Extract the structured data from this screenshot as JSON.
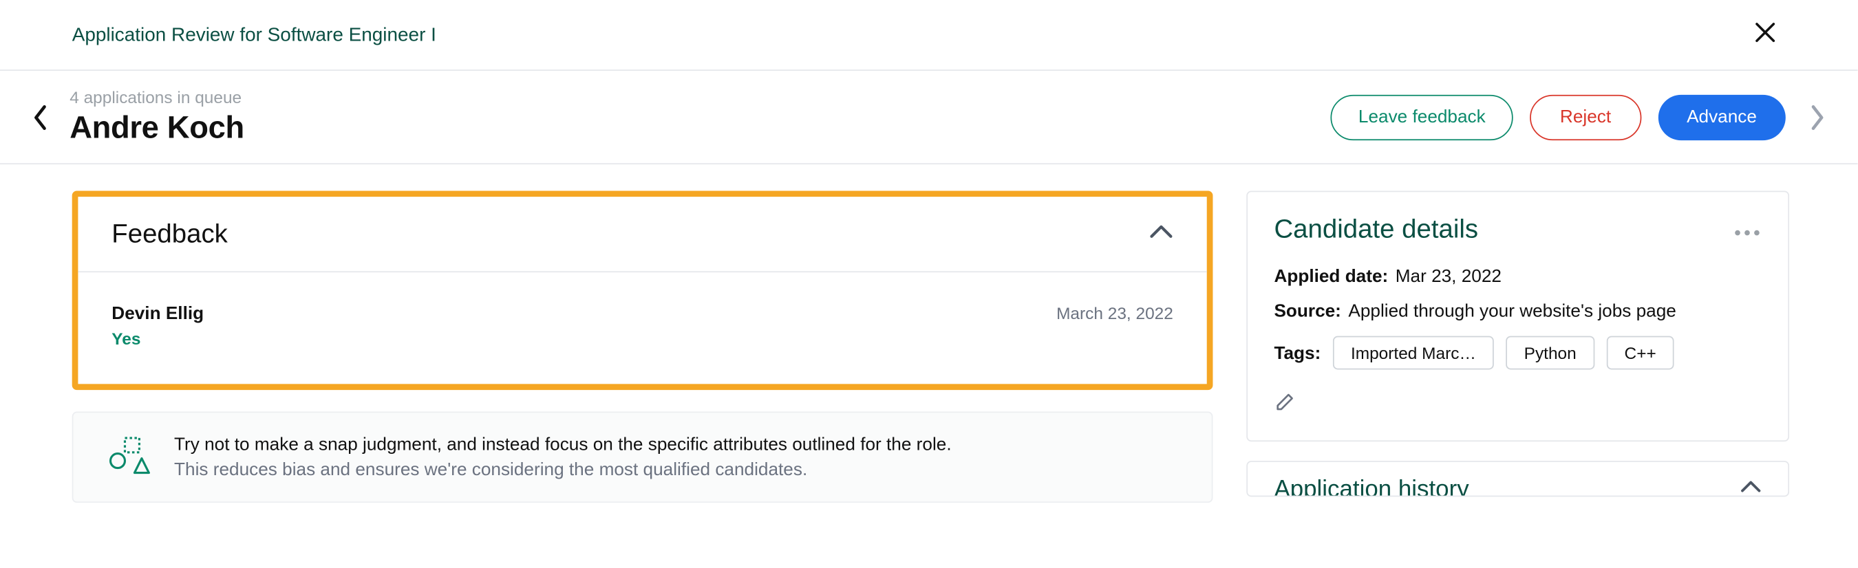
{
  "page": {
    "title": "Application Review for Software Engineer I"
  },
  "header": {
    "queue_text": "4 applications in queue",
    "candidate_name": "Andre Koch",
    "actions": {
      "leave_feedback": "Leave feedback",
      "reject": "Reject",
      "advance": "Advance"
    }
  },
  "feedback": {
    "panel_title": "Feedback",
    "entries": [
      {
        "reviewer": "Devin Ellig",
        "verdict": "Yes",
        "date": "March 23, 2022"
      }
    ]
  },
  "tip": {
    "line1": "Try not to make a snap judgment, and instead focus on the specific attributes outlined for the role.",
    "line2": "This reduces bias and ensures we're considering the most qualified candidates."
  },
  "candidate_details": {
    "panel_title": "Candidate details",
    "applied_date_label": "Applied date:",
    "applied_date_value": "Mar 23, 2022",
    "source_label": "Source:",
    "source_value": "Applied through your website's jobs page",
    "tags_label": "Tags:",
    "tags": [
      "Imported Marc…",
      "Python",
      "C++"
    ]
  },
  "app_history": {
    "panel_title": "Application history"
  }
}
